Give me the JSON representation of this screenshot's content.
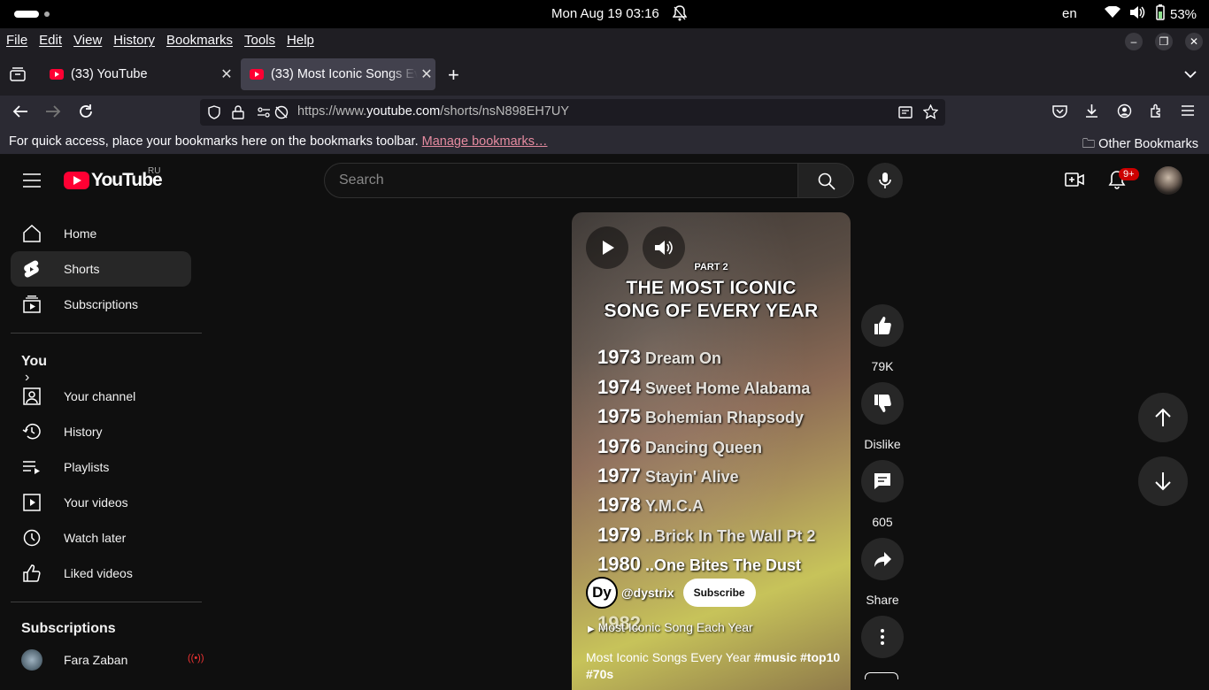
{
  "system": {
    "clock": "Mon Aug 19  03:16",
    "lang": "en",
    "battery": "53%"
  },
  "menubar": {
    "items": [
      "File",
      "Edit",
      "View",
      "History",
      "Bookmarks",
      "Tools",
      "Help"
    ]
  },
  "tabs": [
    {
      "title": "(33) YouTube"
    },
    {
      "title": "(33) Most Iconic Songs Ev"
    }
  ],
  "address": {
    "prefix": "https://www.",
    "domain": "youtube.com",
    "path": "/shorts/nsN898EH7UY"
  },
  "bookmarks": {
    "message": "For quick access, place your bookmarks here on the bookmarks toolbar.",
    "manage": "Manage bookmarks…",
    "other": "Other Bookmarks"
  },
  "youtube": {
    "logo": "YouTube",
    "country": "RU",
    "search_placeholder": "Search",
    "notif_count": "9+"
  },
  "sidebar": {
    "main": [
      "Home",
      "Shorts",
      "Subscriptions"
    ],
    "you_header": "You",
    "you": [
      "Your channel",
      "History",
      "Playlists",
      "Your videos",
      "Watch later",
      "Liked videos"
    ],
    "subs_header": "Subscriptions",
    "subs": [
      {
        "name": "Fara Zaban"
      }
    ]
  },
  "short": {
    "part": "PART 2",
    "title_line1": "THE MOST ICONIC",
    "title_line2": "SONG OF EVERY YEAR",
    "rows": [
      {
        "year": "1973",
        "song": "Dream On"
      },
      {
        "year": "1974",
        "song": "Sweet Home Alabama"
      },
      {
        "year": "1975",
        "song": "Bohemian Rhapsody"
      },
      {
        "year": "1976",
        "song": "Dancing Queen"
      },
      {
        "year": "1977",
        "song": "Stayin' Alive"
      },
      {
        "year": "1978",
        "song": "Y.M.C.A"
      },
      {
        "year": "1979",
        "song": "..Brick In The Wall Pt 2"
      },
      {
        "year": "1980",
        "song": "..One Bites The Dust"
      },
      {
        "year": "1982",
        "song": ""
      }
    ],
    "channel_initials": "Dy",
    "channel": "@dystrix",
    "subscribe": "Subscribe",
    "playlist": "Most Iconic Song Each Year",
    "desc_text": "Most Iconic Songs Every Year ",
    "desc_tags": "#music #top10",
    "desc_tags2": "#70s"
  },
  "actions": {
    "likes": "79K",
    "dislike": "Dislike",
    "comments": "605",
    "share": "Share"
  }
}
